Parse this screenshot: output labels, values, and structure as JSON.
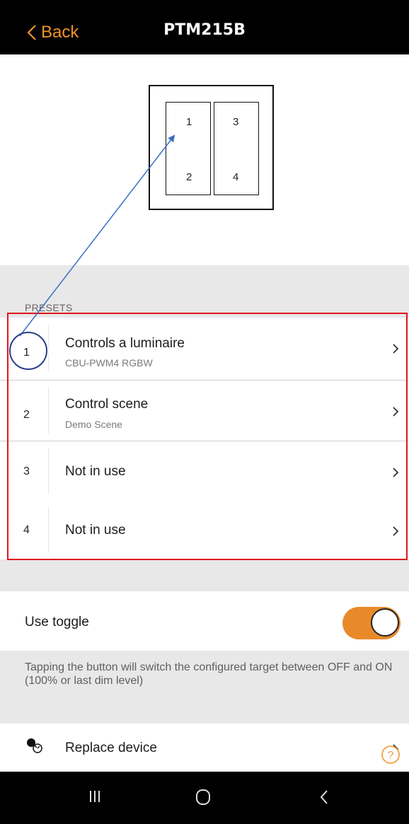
{
  "header": {
    "back_label": "Back",
    "title": "PTM215B"
  },
  "device": {
    "buttons": [
      "1",
      "2",
      "3",
      "4"
    ]
  },
  "presets": {
    "section_label": "PRESETS",
    "items": [
      {
        "number": "1",
        "label": "Controls a luminaire",
        "sublabel": "CBU-PWM4 RGBW"
      },
      {
        "number": "2",
        "label": "Control scene",
        "sublabel": "Demo Scene"
      },
      {
        "number": "3",
        "label": "Not in use",
        "sublabel": ""
      },
      {
        "number": "4",
        "label": "Not in use",
        "sublabel": ""
      }
    ]
  },
  "toggle": {
    "label": "Use toggle",
    "enabled": true,
    "description": "Tapping the button will switch the configured target between OFF and ON (100% or last dim level)"
  },
  "replace": {
    "label": "Replace device",
    "icon": "replace-device-icon",
    "help_icon": "help-icon"
  },
  "colors": {
    "accent": "#f0922b",
    "toggle_on": "#e98a2a",
    "annotation_red": "#e0141b",
    "annotation_blue": "#3b6fc4"
  },
  "navbar": {
    "icons": [
      "recent-apps-icon",
      "home-icon",
      "back-nav-icon"
    ]
  }
}
